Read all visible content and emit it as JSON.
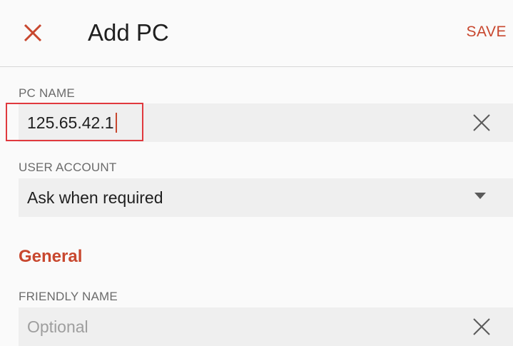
{
  "header": {
    "title": "Add PC",
    "save_label": "SAVE",
    "close_icon": "close-icon",
    "accent_color": "#c8472e"
  },
  "form": {
    "pc_name": {
      "label": "PC NAME",
      "value": "125.65.42.1"
    },
    "user_account": {
      "label": "USER ACCOUNT",
      "selected": "Ask when required"
    },
    "section_general": "General",
    "friendly_name": {
      "label": "FRIENDLY NAME",
      "placeholder": "Optional"
    }
  }
}
